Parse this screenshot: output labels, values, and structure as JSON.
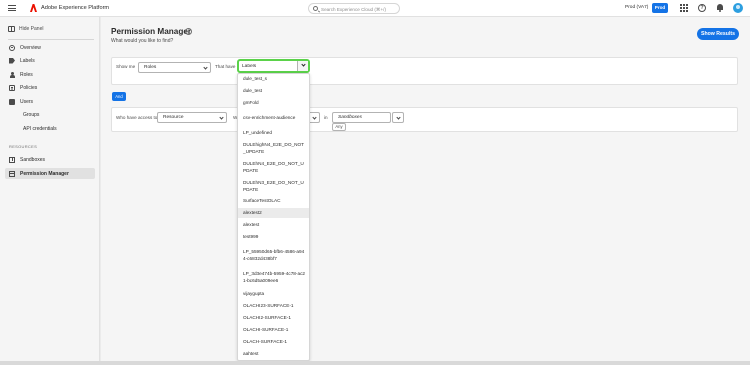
{
  "topbar": {
    "app_title": "Adobe Experience Platform",
    "search_placeholder": "Search Experience Cloud (⌘+/)",
    "sandbox_label": "Prod (VA7)",
    "env_badge": "Prod",
    "help_glyph": "?",
    "icons": [
      "menu-icon",
      "adobe-logo",
      "search-icon",
      "apps-grid-icon",
      "help-icon",
      "bell-icon",
      "avatar"
    ]
  },
  "sidebar": {
    "hide_panel": "Hide Panel",
    "items": [
      {
        "label": "Overview",
        "icon": "overview-icon"
      },
      {
        "label": "Labels",
        "icon": "tag-icon"
      },
      {
        "label": "Roles",
        "icon": "person-icon"
      },
      {
        "label": "Policies",
        "icon": "document-icon"
      },
      {
        "label": "Users",
        "icon": "users-icon"
      },
      {
        "label": "Groups"
      },
      {
        "label": "API credentials"
      }
    ],
    "section_resources": "RESOURCES",
    "resource_items": [
      {
        "label": "Sandboxes",
        "icon": "sandbox-icon"
      },
      {
        "label": "Permission Manager",
        "icon": "permission-icon",
        "active": true
      }
    ]
  },
  "main": {
    "title": "Permission Manager",
    "info_glyph": "i",
    "subtitle": "What would you like to find?",
    "show_results": "Show Results",
    "row1": {
      "show_me_label": "Show me",
      "show_me_value": "Roles",
      "that_have_label": "That have",
      "that_have_value": "Labels"
    },
    "and_button": "And",
    "row2": {
      "who_label": "Who have access to",
      "resource_value": "Resource",
      "w_fragment": "W",
      "in_label": "in",
      "sandbox_value": "Sandboxes",
      "any_tag": "Any"
    }
  },
  "dropdown": {
    "options": [
      "dule_test_s",
      "dule_test",
      "gmFold",
      "csv-enrichment-audience",
      "LP_undefined",
      "DULEhighN4_E2E_DO_NOT_UPDATE",
      "DULEhN4_E2E_DO_NOT_UPDATE",
      "DULEhN3_E2E_DO_NOT_UPDATE",
      "SurfaceTestOLAC",
      "alextest2",
      "alextest",
      "test999",
      "LP_55950d65-bfb6-4586-a944-c6832d438bf7",
      "LP_3d3e474b-5959-4c78-ac21-bc6d5a009ee6",
      "vijaygupta",
      "OLACHI23-SURFACE-1",
      "OLACHI2-SURFACE-1",
      "OLACHI-SURFACE-1",
      "OLACH-SURFACE-1",
      "aahtest"
    ],
    "highlighted_option": "alextest2"
  },
  "colors": {
    "accent": "#1473e6",
    "focus_ring": "#5bd24a",
    "brand": "#eb1000"
  }
}
